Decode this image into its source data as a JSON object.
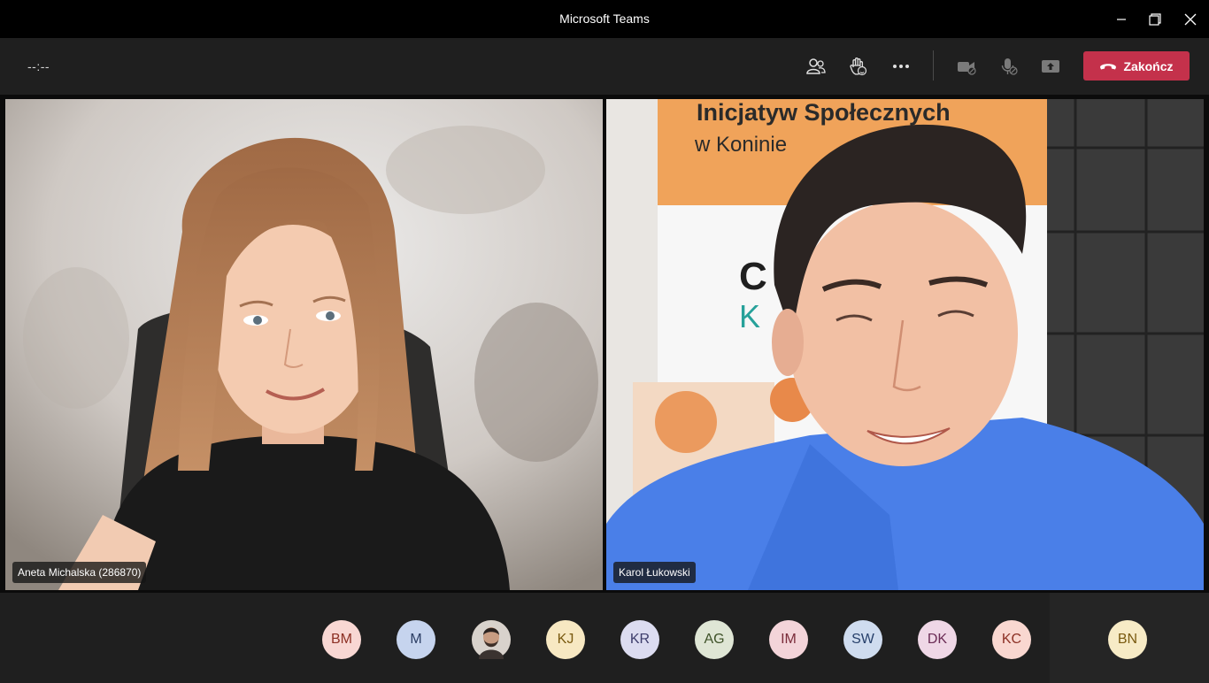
{
  "window": {
    "title": "Microsoft Teams",
    "controls": [
      "minimize-icon",
      "restore-icon",
      "close-icon"
    ]
  },
  "toolbar": {
    "timer": "--:--",
    "icons": [
      "participants-icon",
      "raise-hand-icon",
      "more-options-icon",
      "camera-off-icon",
      "mic-off-icon",
      "share-screen-icon"
    ],
    "end_call": {
      "label": "Zakończ",
      "color": "#c4314b",
      "icon": "phone-hangup-icon"
    }
  },
  "videos": [
    {
      "name": "Aneta Michalska (286870)",
      "banner": {
        "line1": "",
        "line2": ""
      }
    },
    {
      "name": "Karol Łukowski",
      "banner": {
        "line1": "Inicjatyw Społecznych",
        "line2": "w Koninie",
        "logo_text": "CI Ko"
      }
    }
  ],
  "participants": [
    {
      "initials": "BM",
      "bg": "#f8d7d3",
      "fg": "#8c3024"
    },
    {
      "initials": "M",
      "bg": "#c6d4ee",
      "fg": "#2b3d63"
    },
    {
      "initials": "",
      "bg": "#6b5a4d",
      "fg": "#ffffff",
      "photo": true
    },
    {
      "initials": "KJ",
      "bg": "#f7e8c2",
      "fg": "#7a5a10"
    },
    {
      "initials": "KR",
      "bg": "#dcdcf0",
      "fg": "#3d3d6b"
    },
    {
      "initials": "AG",
      "bg": "#dfe6d5",
      "fg": "#3e5228"
    },
    {
      "initials": "IM",
      "bg": "#f3d4d9",
      "fg": "#7a2c3a"
    },
    {
      "initials": "SW",
      "bg": "#cfdcef",
      "fg": "#27406b"
    },
    {
      "initials": "DK",
      "bg": "#efd7e6",
      "fg": "#6b2c55"
    },
    {
      "initials": "KC",
      "bg": "#f9d7d0",
      "fg": "#8c3024"
    },
    {
      "initials": "BN",
      "bg": "#f7ebc6",
      "fg": "#7a5a10"
    }
  ]
}
